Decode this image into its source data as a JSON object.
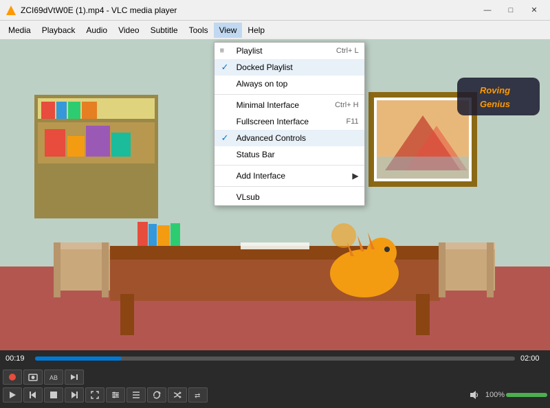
{
  "titleBar": {
    "title": "ZCI69dVtW0E (1).mp4 - VLC media player",
    "minBtn": "—",
    "maxBtn": "□",
    "closeBtn": "✕"
  },
  "menuBar": {
    "items": [
      {
        "id": "media",
        "label": "Media"
      },
      {
        "id": "playback",
        "label": "Playback"
      },
      {
        "id": "audio",
        "label": "Audio"
      },
      {
        "id": "video",
        "label": "Video"
      },
      {
        "id": "subtitle",
        "label": "Subtitle"
      },
      {
        "id": "tools",
        "label": "Tools"
      },
      {
        "id": "view",
        "label": "View",
        "active": true
      },
      {
        "id": "help",
        "label": "Help"
      }
    ]
  },
  "viewMenu": {
    "items": [
      {
        "id": "playlist",
        "label": "Playlist",
        "shortcut": "Ctrl+ L",
        "check": false,
        "separator_after": false
      },
      {
        "id": "docked-playlist",
        "label": "Docked Playlist",
        "shortcut": "",
        "check": true,
        "checked_blue": true,
        "separator_after": false
      },
      {
        "id": "always-on-top",
        "label": "Always on top",
        "shortcut": "",
        "check": false,
        "separator_after": true
      },
      {
        "id": "minimal-interface",
        "label": "Minimal Interface",
        "shortcut": "Ctrl+ H",
        "check": false,
        "separator_after": false
      },
      {
        "id": "fullscreen-interface",
        "label": "Fullscreen Interface",
        "shortcut": "F11",
        "check": false,
        "separator_after": false
      },
      {
        "id": "advanced-controls",
        "label": "Advanced Controls",
        "shortcut": "",
        "check": true,
        "checked_blue": true,
        "separator_after": false
      },
      {
        "id": "status-bar",
        "label": "Status Bar",
        "shortcut": "",
        "check": false,
        "separator_after": true
      },
      {
        "id": "add-interface",
        "label": "Add Interface",
        "shortcut": "",
        "check": false,
        "has_arrow": true,
        "separator_after": true
      },
      {
        "id": "vlsub",
        "label": "VLsub",
        "shortcut": "",
        "check": false,
        "separator_after": false
      }
    ]
  },
  "progress": {
    "current": "00:19",
    "total": "02:00",
    "fill_pct": 18
  },
  "controls": {
    "row1": [
      {
        "id": "record",
        "icon": "⏺",
        "title": "Record"
      },
      {
        "id": "snapshot",
        "icon": "📷",
        "title": "Snapshot"
      },
      {
        "id": "loop-ab",
        "icon": "🔁",
        "title": "Loop A-B"
      },
      {
        "id": "frame-step",
        "icon": "⏭",
        "title": "Frame Step"
      }
    ],
    "row2": [
      {
        "id": "play",
        "icon": "▶",
        "title": "Play"
      },
      {
        "id": "prev",
        "icon": "⏮",
        "title": "Previous"
      },
      {
        "id": "stop",
        "icon": "⏹",
        "title": "Stop"
      },
      {
        "id": "next",
        "icon": "⏭",
        "title": "Next"
      },
      {
        "id": "fullscreen",
        "icon": "⛶",
        "title": "Fullscreen"
      },
      {
        "id": "extended",
        "icon": "🎛",
        "title": "Extended Settings"
      },
      {
        "id": "playlist-btn",
        "icon": "☰",
        "title": "Playlist"
      },
      {
        "id": "loop",
        "icon": "🔄",
        "title": "Loop"
      },
      {
        "id": "random",
        "icon": "🔀",
        "title": "Random"
      },
      {
        "id": "shuffle",
        "icon": "⇄",
        "title": "Shuffle"
      }
    ],
    "volume_pct": "100%",
    "volume_fill": 100
  }
}
